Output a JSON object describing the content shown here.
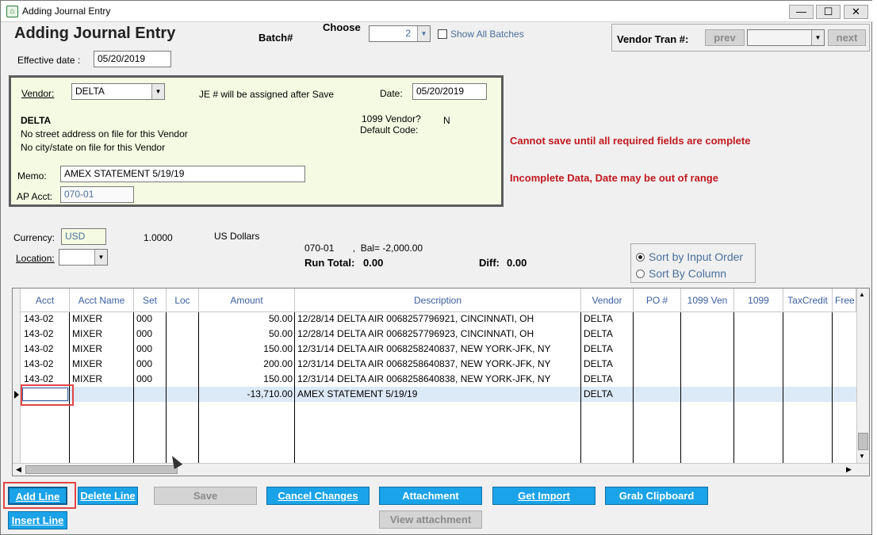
{
  "window": {
    "title": "Adding Journal Entry",
    "min": "—",
    "max": "☐",
    "close": "✕"
  },
  "header": {
    "title": "Adding Journal Entry",
    "batch_label": "Batch#",
    "choose_label": "Choose",
    "batch_value": "2",
    "show_all_batches": "Show All Batches",
    "effective_date_label": "Effective date :",
    "effective_date": "05/20/2019",
    "vendor_tran_label": "Vendor Tran #:",
    "prev_label": "prev",
    "next_label": "next"
  },
  "vendor_panel": {
    "vendor_label": "Vendor:",
    "vendor_value": "DELTA",
    "je_note": "JE # will be assigned after Save",
    "date_label": "Date:",
    "date_value": "05/20/2019",
    "vendor_name": "DELTA",
    "address_line1": "No street address on file for this Vendor",
    "address_line2": "No city/state on file for this Vendor",
    "v1099_label": "1099 Vendor?",
    "v1099_value": "N",
    "default_code_label": "Default Code:",
    "memo_label": "Memo:",
    "memo_value": "AMEX STATEMENT 5/19/19",
    "ap_acct_label": "AP Acct:",
    "ap_acct_value": "070-01"
  },
  "messages": {
    "error1": "Cannot save until all required fields are complete",
    "error2": "Incomplete Data, Date may be out of range"
  },
  "currency": {
    "currency_label": "Currency:",
    "currency_value": "USD",
    "rate": "1.0000",
    "name": "US Dollars",
    "location_label": "Location:",
    "acct_bal": "070-01       ,  Bal= -2,000.00",
    "run_total_label": "Run Total:",
    "run_total": "0.00",
    "diff_label": "Diff:",
    "diff": "0.00"
  },
  "sort": {
    "input_order": "Sort by Input Order",
    "by_column": "Sort By Column"
  },
  "grid": {
    "columns": [
      "Acct",
      "Acct Name",
      "Set",
      "Loc",
      "Amount",
      "Description",
      "Vendor",
      "PO #",
      "1099 Ven",
      "1099",
      "TaxCredit",
      "Free"
    ],
    "rows": [
      [
        "143-02",
        "MIXER",
        "000",
        "",
        "50.00",
        "12/28/14 DELTA AIR 0068257796921, CINCINNATI, OH",
        "DELTA"
      ],
      [
        "143-02",
        "MIXER",
        "000",
        "",
        "50.00",
        "12/28/14 DELTA AIR 0068257796923, CINCINNATI, OH",
        "DELTA"
      ],
      [
        "143-02",
        "MIXER",
        "000",
        "",
        "150.00",
        "12/31/14 DELTA AIR 0068258240837, NEW YORK-JFK, NY",
        "DELTA"
      ],
      [
        "143-02",
        "MIXER",
        "000",
        "",
        "200.00",
        "12/31/14 DELTA AIR 0068258640837, NEW YORK-JFK, NY",
        "DELTA"
      ],
      [
        "143-02",
        "MIXER",
        "000",
        "",
        "150.00",
        "12/31/14 DELTA AIR 0068258640838, NEW YORK-JFK, NY",
        "DELTA"
      ],
      [
        "",
        "",
        "",
        "",
        "-13,710.00",
        "AMEX STATEMENT 5/19/19",
        "DELTA"
      ]
    ]
  },
  "buttons": {
    "add_line": "Add Line",
    "delete_line": "Delete Line",
    "save": "Save",
    "cancel_changes": "Cancel Changes",
    "attachment": "Attachment",
    "get_import": "Get Import",
    "grab_clipboard": "Grab Clipboard",
    "insert_line": "Insert Line",
    "view_attachment": "View attachment"
  },
  "colors": {
    "accent_button": "#1aa3e8",
    "panel_bg": "#f4fbe2",
    "error": "#c0181f",
    "selected_row": "#dce9f7"
  }
}
